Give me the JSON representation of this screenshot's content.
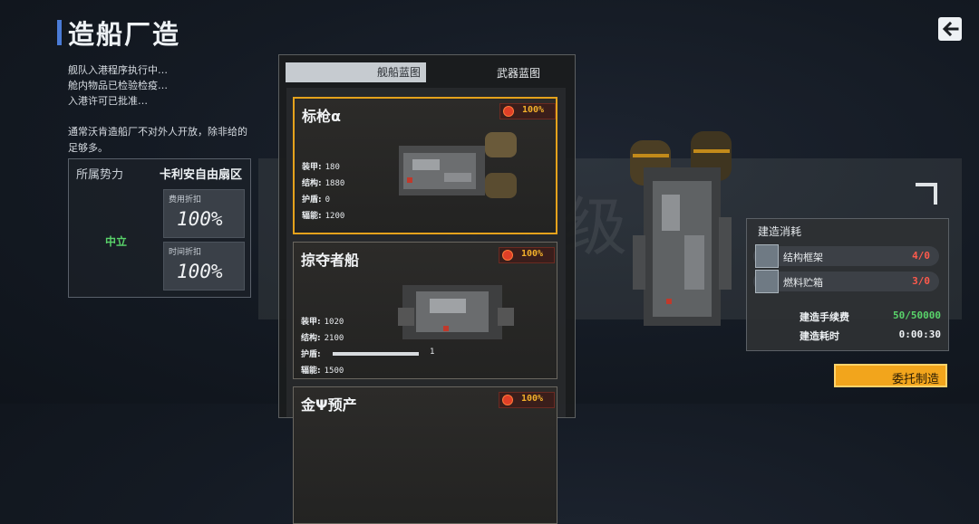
{
  "header": {
    "title": "造船厂造"
  },
  "messages": [
    "舰队入港程序执行中…",
    "舱内物品已检验检疫…",
    "入港许可已批准…"
  ],
  "description": "通常沃肯造船厂不对外人开放，除非给的足够多。",
  "faction": {
    "label": "所属势力",
    "value": "卡利安自由扇区",
    "status": "中立",
    "cost_discount_label": "费用折扣",
    "cost_discount_value": "100%",
    "time_discount_label": "时间折扣",
    "time_discount_value": "100%"
  },
  "tabs": [
    {
      "label": "舰船蓝图",
      "active": true
    },
    {
      "label": "武器蓝图",
      "active": false
    }
  ],
  "ships": [
    {
      "name": "标枪α",
      "badge": "100%",
      "selected": true,
      "stats": [
        {
          "label": "装甲:",
          "value": "180"
        },
        {
          "label": "结构:",
          "value": "1880"
        },
        {
          "label": "护盾:",
          "value": "0"
        },
        {
          "label": "辐能:",
          "value": "1200"
        }
      ]
    },
    {
      "name": "掠夺者船",
      "badge": "100%",
      "selected": false,
      "stats": [
        {
          "label": "装甲:",
          "value": "1020"
        },
        {
          "label": "结构:",
          "value": "2100"
        },
        {
          "label": "护盾:",
          "value": "1",
          "bar": 1.0
        },
        {
          "label": "辐能:",
          "value": "1500"
        }
      ]
    },
    {
      "name": "金Ψ预产",
      "badge": "100%",
      "selected": false
    }
  ],
  "watermark": "分子级",
  "build_cost": {
    "title": "建造消耗",
    "items": [
      {
        "label": "结构框架",
        "value": "4/0",
        "icon": "frame-icon"
      },
      {
        "label": "燃料贮箱",
        "value": "3/0",
        "icon": "fuel-tank-icon"
      }
    ],
    "fee_label": "建造手续费",
    "fee_value": "50/50000",
    "time_label": "建造耗时",
    "time_value": "0:00:30"
  },
  "commission_button": "委托制造",
  "colors": {
    "accent": "#f2a51c",
    "title_bar": "#4a7bd6",
    "neutral": "#59d36a",
    "cost_red": "#ff5a4c",
    "fee_green": "#59d36a"
  }
}
